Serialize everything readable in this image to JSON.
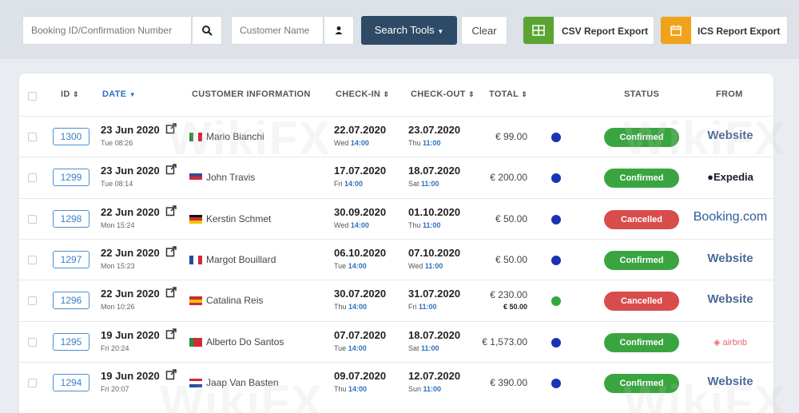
{
  "toolbar": {
    "booking_placeholder": "Booking ID/Confirmation Number",
    "customer_placeholder": "Customer Name",
    "search_tools_label": "Search Tools",
    "clear_label": "Clear",
    "csv_label": "CSV Report Export",
    "ics_label": "ICS Report Export"
  },
  "table": {
    "headers": {
      "id": "ID",
      "date": "DATE",
      "customer": "CUSTOMER INFORMATION",
      "checkin": "CHECK-IN",
      "checkout": "CHECK-OUT",
      "total": "TOTAL",
      "status": "STATUS",
      "from": "FROM"
    },
    "rows": [
      {
        "id": "1300",
        "date": "23 Jun 2020",
        "date_sub": "Tue 08:26",
        "flag": "it",
        "customer": "Mario Bianchi",
        "checkin": "22.07.2020",
        "checkin_day": "Wed",
        "checkin_time": "14:00",
        "checkout": "23.07.2020",
        "checkout_day": "Thu",
        "checkout_time": "11:00",
        "total": "€ 99.00",
        "total2": "",
        "dot": "#1a33b3",
        "status": "Confirmed",
        "status_color": "#3aa540",
        "from": "Website",
        "from_kind": "website"
      },
      {
        "id": "1299",
        "date": "23 Jun 2020",
        "date_sub": "Tue 08:14",
        "flag": "us",
        "customer": "John Travis",
        "checkin": "17.07.2020",
        "checkin_day": "Fri",
        "checkin_time": "14:00",
        "checkout": "18.07.2020",
        "checkout_day": "Sat",
        "checkout_time": "11:00",
        "total": "€ 200.00",
        "total2": "",
        "dot": "#1a33b3",
        "status": "Confirmed",
        "status_color": "#3aa540",
        "from": "Expedia",
        "from_kind": "expedia"
      },
      {
        "id": "1298",
        "date": "22 Jun 2020",
        "date_sub": "Mon 15:24",
        "flag": "de",
        "customer": "Kerstin Schmet",
        "checkin": "30.09.2020",
        "checkin_day": "Wed",
        "checkin_time": "14:00",
        "checkout": "01.10.2020",
        "checkout_day": "Thu",
        "checkout_time": "11:00",
        "total": "€ 50.00",
        "total2": "",
        "dot": "#1a33b3",
        "status": "Cancelled",
        "status_color": "#d94c4c",
        "from": "Booking.com",
        "from_kind": "booking"
      },
      {
        "id": "1297",
        "date": "22 Jun 2020",
        "date_sub": "Mon 15:23",
        "flag": "fr",
        "customer": "Margot Bouillard",
        "checkin": "06.10.2020",
        "checkin_day": "Tue",
        "checkin_time": "14:00",
        "checkout": "07.10.2020",
        "checkout_day": "Wed",
        "checkout_time": "11:00",
        "total": "€ 50.00",
        "total2": "",
        "dot": "#1a33b3",
        "status": "Confirmed",
        "status_color": "#3aa540",
        "from": "Website",
        "from_kind": "website"
      },
      {
        "id": "1296",
        "date": "22 Jun 2020",
        "date_sub": "Mon 10:26",
        "flag": "es",
        "customer": "Catalina Reis",
        "checkin": "30.07.2020",
        "checkin_day": "Thu",
        "checkin_time": "14:00",
        "checkout": "31.07.2020",
        "checkout_day": "Fri",
        "checkout_time": "11:00",
        "total": "€ 230.00",
        "total2": "€ 50.00",
        "dot": "#2eaa3c",
        "status": "Cancelled",
        "status_color": "#d94c4c",
        "from": "Website",
        "from_kind": "website"
      },
      {
        "id": "1295",
        "date": "19 Jun 2020",
        "date_sub": "Fri 20:24",
        "flag": "pt",
        "customer": "Alberto Do Santos",
        "checkin": "07.07.2020",
        "checkin_day": "Tue",
        "checkin_time": "14:00",
        "checkout": "18.07.2020",
        "checkout_day": "Sat",
        "checkout_time": "11:00",
        "total": "€ 1,573.00",
        "total2": "",
        "dot": "#1a33b3",
        "status": "Confirmed",
        "status_color": "#3aa540",
        "from": "airbnb",
        "from_kind": "airbnb"
      },
      {
        "id": "1294",
        "date": "19 Jun 2020",
        "date_sub": "Fri 20:07",
        "flag": "nl",
        "customer": "Jaap Van Basten",
        "checkin": "09.07.2020",
        "checkin_day": "Thu",
        "checkin_time": "14:00",
        "checkout": "12.07.2020",
        "checkout_day": "Sun",
        "checkout_time": "11:00",
        "total": "€ 390.00",
        "total2": "",
        "dot": "#1a33b3",
        "status": "Confirmed",
        "status_color": "#3aa540",
        "from": "Website",
        "from_kind": "website"
      }
    ]
  },
  "watermark": "WikiFX",
  "colors": {
    "accent": "#2f6fbf",
    "search_tools_bg": "#2d4a66",
    "csv_green": "#5aa532",
    "ics_orange": "#f0a21a",
    "confirmed": "#3aa540",
    "cancelled": "#d94c4c"
  }
}
